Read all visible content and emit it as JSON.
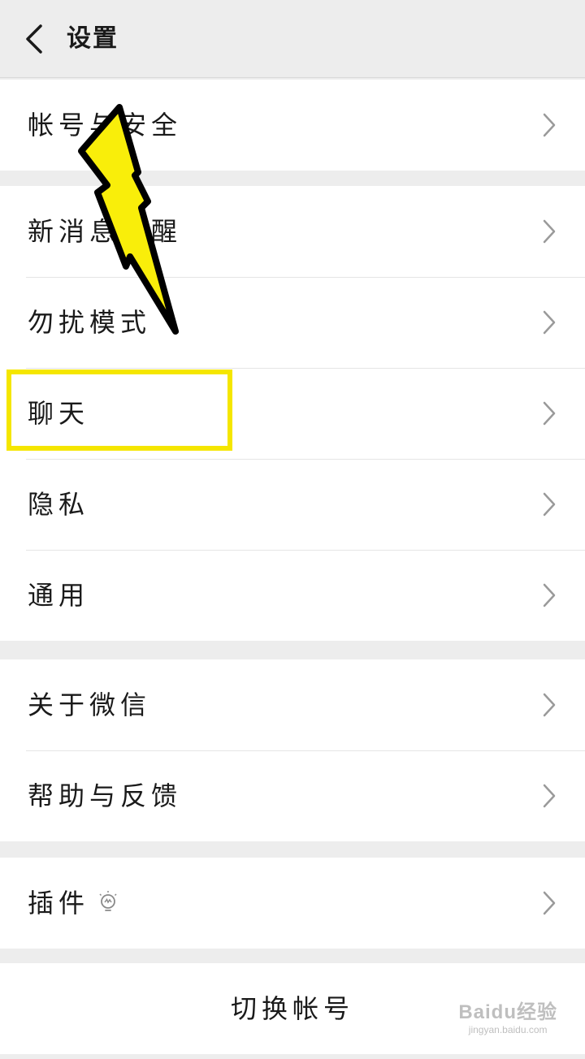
{
  "header": {
    "title": "设置",
    "back_icon": "chevron-left-icon"
  },
  "groups": [
    {
      "items": [
        {
          "label": "帐号与安全"
        }
      ]
    },
    {
      "items": [
        {
          "label": "新消息提醒"
        },
        {
          "label": "勿扰模式"
        },
        {
          "label": "聊天"
        },
        {
          "label": "隐私"
        },
        {
          "label": "通用"
        }
      ]
    },
    {
      "items": [
        {
          "label": "关于微信"
        },
        {
          "label": "帮助与反馈"
        }
      ]
    },
    {
      "items": [
        {
          "label": "插件",
          "icon": "lightbulb-icon"
        }
      ]
    }
  ],
  "footer": {
    "switch_account_label": "切换帐号"
  },
  "annotation": {
    "highlight_color": "#f5e600"
  },
  "watermark": {
    "main": "Baidu经验",
    "sub": "jingyan.baidu.com"
  }
}
